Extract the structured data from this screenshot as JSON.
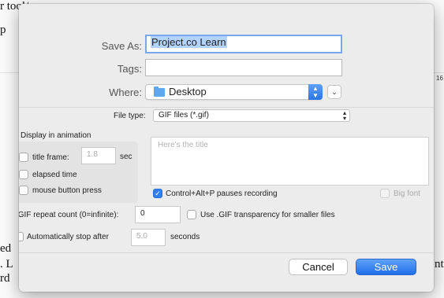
{
  "background": {
    "fragments": [
      "r tool/",
      "p",
      "ed",
      ". L",
      "rd",
      "nt",
      "16"
    ]
  },
  "dialog": {
    "save_as_label": "Save As:",
    "save_as_value": "Project.co Learn",
    "tags_label": "Tags:",
    "tags_value": "",
    "where_label": "Where:",
    "where_value": "Desktop",
    "where_icon": "folder-icon",
    "expand_icon": "chevron-down-icon",
    "file_type_label": "File type:",
    "file_type_value": "GIF files (*.gif)",
    "display_group_title": "Display in animation",
    "title_frame_label": "title frame:",
    "title_frame_value": "1.8",
    "title_frame_unit": "sec",
    "elapsed_time_label": "elapsed time",
    "mouse_press_label": "mouse button press",
    "title_placeholder": "Here's the title",
    "pause_hotkey_label": "Control+Alt+P pauses recording",
    "pause_hotkey_checked": true,
    "big_font_label": "Big font",
    "repeat_label": ".GIF repeat count (0=infinite):",
    "repeat_value": "0",
    "transparency_label": "Use .GIF transparency for smaller files",
    "auto_stop_label": "Automatically stop after",
    "auto_stop_value": "5.0",
    "auto_stop_unit": "seconds",
    "cancel_label": "Cancel",
    "save_label": "Save",
    "accent_color": "#2f7ff0"
  }
}
